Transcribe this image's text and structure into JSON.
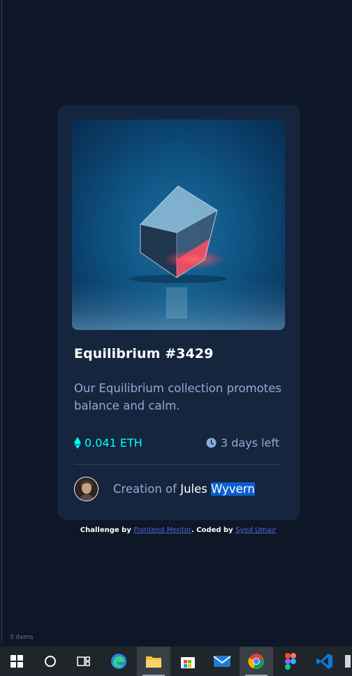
{
  "card": {
    "title": "Equilibrium #3429",
    "description": "Our Equilibrium collection promotes balance and calm.",
    "price": "0.041 ETH",
    "time_left": "3 days left",
    "creator_prefix": "Creation of ",
    "creator_first": "Jules",
    "creator_last": "Wyvern"
  },
  "footer": {
    "challenge_prefix": "Challenge by ",
    "challenge_link": "Frontend Mentor",
    "coded_prefix": ". Coded by ",
    "coded_link": "Syed Umair"
  },
  "taskbar_stub": "3 items",
  "taskbar": {
    "items": [
      "windows-start",
      "cortana",
      "task-view",
      "edge",
      "file-explorer",
      "microsoft-store",
      "mail",
      "chrome",
      "figma",
      "vscode"
    ]
  },
  "colors": {
    "background": "#0d1728",
    "card": "#15253d",
    "cyan": "#00fff8",
    "soft_blue": "#8bacd9",
    "link": "#5367e0",
    "selection": "#0b5fd0"
  }
}
